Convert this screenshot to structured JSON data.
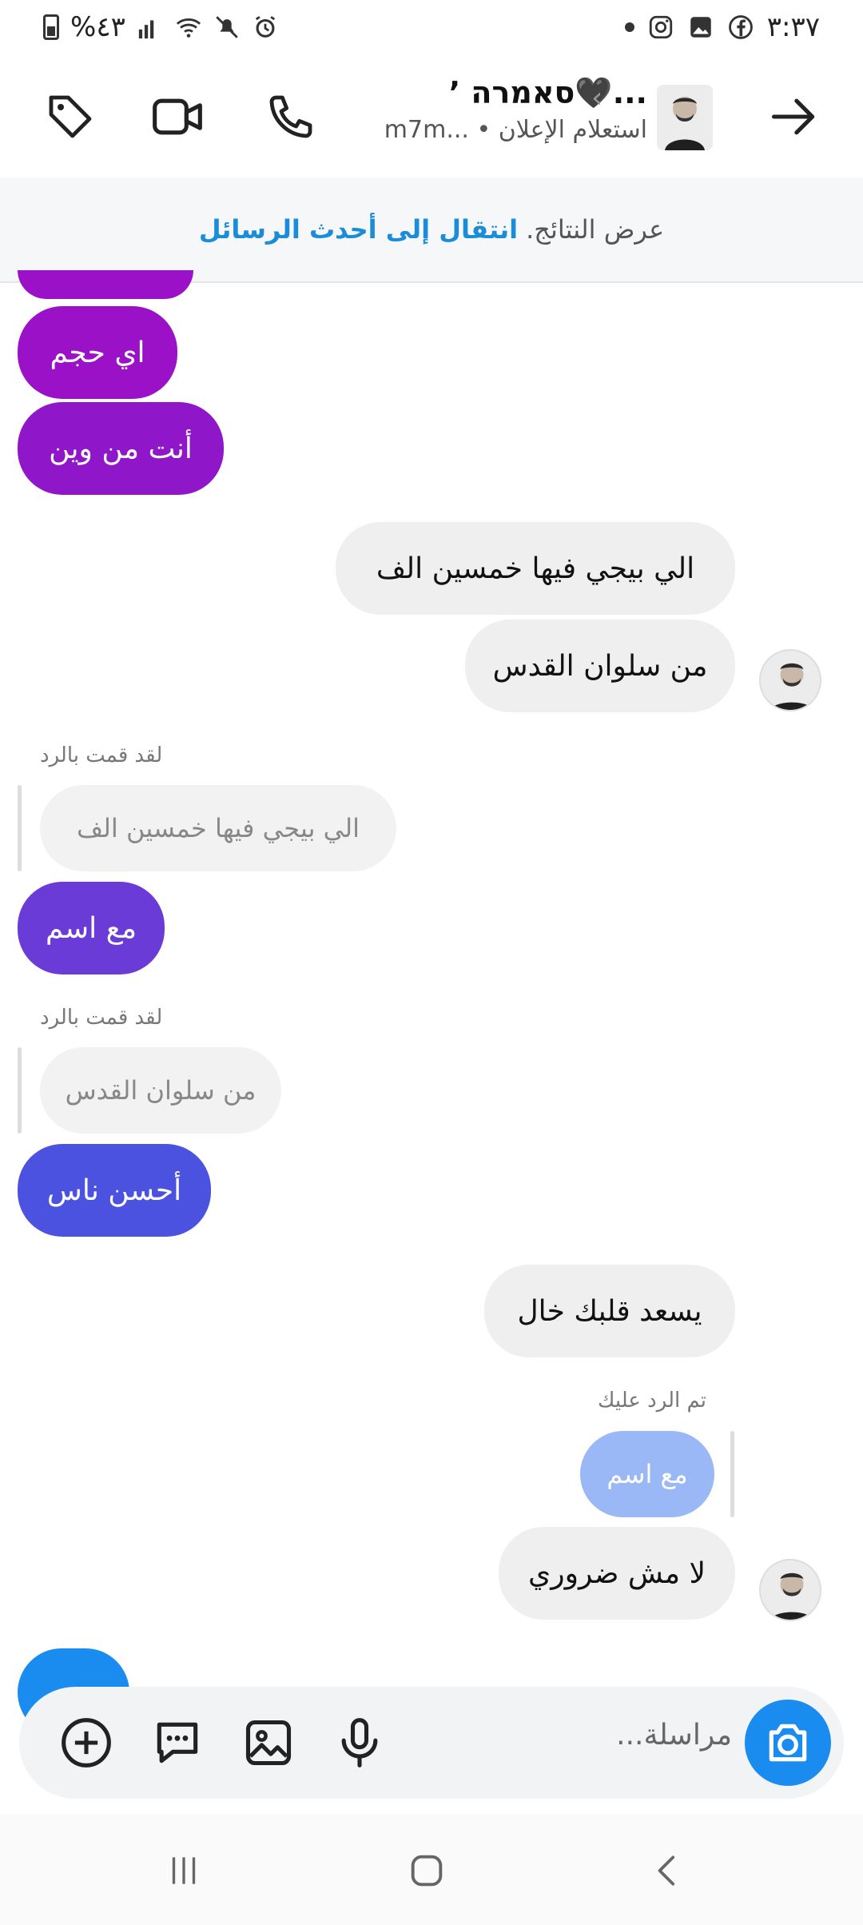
{
  "status_bar": {
    "time": "٣:٣٧",
    "battery": "%٤٣"
  },
  "header": {
    "title": "ʼ סאמרה🖤...",
    "subtitle": "m7m... • استعلام الإعلان"
  },
  "results_bar": {
    "show_results": "عرض النتائج.",
    "jump_latest": "انتقال إلى أحدث الرسائل"
  },
  "messages": [
    {
      "id": "m1",
      "side": "mine",
      "text": "اي حجم",
      "color": "#9b11c8"
    },
    {
      "id": "m2",
      "side": "mine",
      "text": "أنت من وين",
      "color": "#9016c9"
    },
    {
      "id": "m3",
      "side": "theirs",
      "text": "الي بيجي فيها  خمسين الف"
    },
    {
      "id": "m4",
      "side": "theirs",
      "text": "من سلوان القدس"
    },
    {
      "id": "m5",
      "side": "mine",
      "reply_label": "لقد قمت بالرد",
      "quote": "الي بيجي فيها  خمسين الف",
      "text": "مع اسم",
      "color": "#6a3bd6"
    },
    {
      "id": "m6",
      "side": "mine",
      "reply_label": "لقد قمت بالرد",
      "quote": "من سلوان القدس",
      "text": "أحسن ناس",
      "color": "#4b52e0"
    },
    {
      "id": "m7",
      "side": "theirs",
      "text": "يسعد قلبك خال"
    },
    {
      "id": "m8",
      "side": "theirs",
      "reply_label": "تم الرد عليك",
      "quote": "مع اسم",
      "text": "لا مش ضروري"
    }
  ],
  "composer": {
    "placeholder": "مراسلة..."
  },
  "colors": {
    "accent": "#1a8cd8",
    "camera": "#1a8cf0",
    "quote_mine_bg": "#9ab8f5"
  }
}
